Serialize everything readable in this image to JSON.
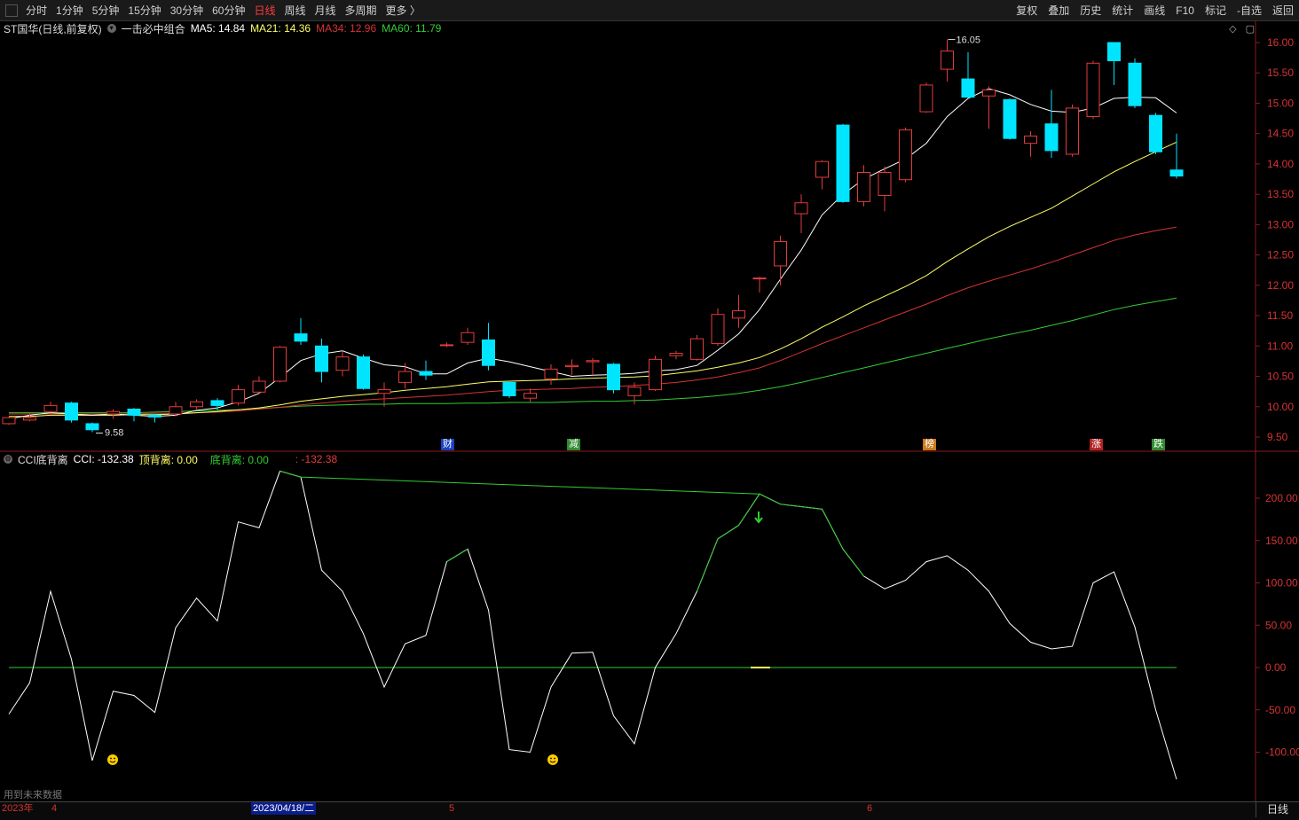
{
  "toolbar": {
    "periods": [
      "分时",
      "1分钟",
      "5分钟",
      "15分钟",
      "30分钟",
      "60分钟",
      "日线",
      "周线",
      "月线",
      "多周期",
      "更多 〉"
    ],
    "active": "日线",
    "right_items": [
      "复权",
      "叠加",
      "历史",
      "统计",
      "画线",
      "F10",
      "标记",
      "-自选",
      "返回"
    ]
  },
  "main": {
    "title": "ST国华(日线,前复权)",
    "indicator": "一击必中组合",
    "ma5": "MA5: 14.84",
    "ma21": "MA21: 14.36",
    "ma34": "MA34: 12.96",
    "ma60": "MA60: 11.79",
    "high_label": "16.05",
    "low_label": "9.58",
    "price_ticks": [
      "16.00",
      "15.50",
      "15.00",
      "14.50",
      "14.00",
      "13.50",
      "13.00",
      "12.50",
      "12.00",
      "11.50",
      "11.00",
      "10.50",
      "10.00",
      "9.50"
    ]
  },
  "badges": [
    {
      "label": "财",
      "color": "#1a3fbf"
    },
    {
      "label": "减",
      "color": "#2e8b2e"
    },
    {
      "label": "榜",
      "color": "#c87a1a"
    },
    {
      "label": "涨",
      "color": "#b22222"
    },
    {
      "label": "跌",
      "color": "#2e8b2e"
    }
  ],
  "sub": {
    "title": "CCI底背离",
    "cci": "CCI: -132.38",
    "top_div": "顶背离: 0.00",
    "bottom_div": "底背离: 0.00",
    "extra": ": -132.38",
    "ticks": [
      "200.00",
      "150.00",
      "100.00",
      "50.00",
      "0.00",
      "-50.00",
      "-100.00"
    ]
  },
  "footer": {
    "watermark": "用到未来数据",
    "year": "2023年",
    "m4": "4",
    "selected_date": "2023/04/18/二",
    "m5": "5",
    "m6": "6",
    "period": "日线"
  },
  "colors": {
    "up": "#e33b3b",
    "down": "#00e5ff",
    "ma5": "#ffffff",
    "ma21": "#ffff66",
    "ma34": "#d63333",
    "ma60": "#33cc33"
  },
  "chart_data": {
    "type": "candlestick",
    "candles": [
      [
        9.72,
        9.82,
        9.84,
        9.7
      ],
      [
        9.78,
        9.82,
        9.9,
        9.76
      ],
      [
        9.92,
        10.02,
        10.08,
        9.9
      ],
      [
        10.06,
        9.78,
        10.08,
        9.74
      ],
      [
        9.72,
        9.62,
        9.74,
        9.58
      ],
      [
        9.88,
        9.92,
        9.96,
        9.8
      ],
      [
        9.96,
        9.86,
        9.98,
        9.76
      ],
      [
        9.86,
        9.83,
        9.88,
        9.74
      ],
      [
        9.88,
        10.0,
        10.08,
        9.84
      ],
      [
        10.0,
        10.08,
        10.12,
        9.96
      ],
      [
        10.1,
        10.02,
        10.14,
        9.94
      ],
      [
        10.06,
        10.28,
        10.36,
        10.02
      ],
      [
        10.24,
        10.42,
        10.5,
        10.22
      ],
      [
        10.42,
        10.98,
        11.0,
        10.4
      ],
      [
        11.2,
        11.08,
        11.46,
        11.02
      ],
      [
        11.0,
        10.58,
        11.12,
        10.4
      ],
      [
        10.6,
        10.82,
        10.9,
        10.5
      ],
      [
        10.82,
        10.3,
        10.86,
        10.28
      ],
      [
        10.22,
        10.28,
        10.4,
        10.0
      ],
      [
        10.4,
        10.58,
        10.72,
        10.3
      ],
      [
        10.58,
        10.52,
        10.76,
        10.44
      ],
      [
        11.02,
        11.02,
        11.06,
        10.98
      ],
      [
        11.06,
        11.22,
        11.3,
        11.02
      ],
      [
        11.1,
        10.68,
        11.38,
        10.6
      ],
      [
        10.4,
        10.18,
        10.42,
        10.14
      ],
      [
        10.14,
        10.22,
        10.3,
        10.08
      ],
      [
        10.46,
        10.62,
        10.7,
        10.36
      ],
      [
        10.66,
        10.68,
        10.78,
        10.52
      ],
      [
        10.74,
        10.76,
        10.8,
        10.52
      ],
      [
        10.7,
        10.28,
        10.72,
        10.22
      ],
      [
        10.18,
        10.32,
        10.4,
        10.04
      ],
      [
        10.28,
        10.78,
        10.84,
        10.26
      ],
      [
        10.84,
        10.88,
        10.92,
        10.78
      ],
      [
        10.78,
        11.12,
        11.18,
        10.76
      ],
      [
        11.04,
        11.52,
        11.62,
        11.0
      ],
      [
        11.46,
        11.58,
        11.84,
        11.3
      ],
      [
        12.12,
        12.12,
        12.14,
        11.88
      ],
      [
        12.32,
        12.72,
        12.82,
        12.0
      ],
      [
        13.18,
        13.36,
        13.5,
        12.86
      ],
      [
        13.78,
        14.04,
        14.06,
        13.58
      ],
      [
        14.64,
        13.38,
        14.66,
        13.36
      ],
      [
        13.38,
        13.86,
        13.98,
        13.3
      ],
      [
        13.48,
        13.86,
        13.96,
        13.22
      ],
      [
        13.74,
        14.56,
        14.6,
        13.7
      ],
      [
        14.86,
        15.3,
        15.34,
        14.84
      ],
      [
        15.56,
        15.86,
        16.05,
        15.36
      ],
      [
        15.4,
        15.1,
        15.84,
        15.08
      ],
      [
        15.12,
        15.22,
        15.28,
        14.58
      ],
      [
        15.06,
        14.42,
        15.08,
        14.4
      ],
      [
        14.34,
        14.46,
        14.54,
        14.12
      ],
      [
        14.66,
        14.22,
        15.22,
        14.1
      ],
      [
        14.16,
        14.92,
        14.98,
        14.12
      ],
      [
        14.78,
        15.66,
        15.7,
        14.74
      ],
      [
        16.0,
        15.7,
        16.0,
        15.3
      ],
      [
        15.66,
        14.96,
        15.74,
        14.92
      ],
      [
        14.8,
        14.2,
        14.84,
        14.16
      ],
      [
        13.9,
        13.8,
        14.5,
        13.76
      ]
    ],
    "ma5": [
      9.8,
      9.86,
      9.9,
      9.88,
      9.86,
      9.88,
      9.86,
      9.84,
      9.86,
      9.94,
      9.98,
      10.08,
      10.22,
      10.48,
      10.76,
      10.87,
      10.92,
      10.8,
      10.69,
      10.66,
      10.54,
      10.54,
      10.72,
      10.8,
      10.74,
      10.66,
      10.58,
      10.5,
      10.52,
      10.53,
      10.55,
      10.59,
      10.61,
      10.68,
      10.93,
      11.2,
      11.6,
      12.1,
      12.58,
      13.16,
      13.5,
      13.75,
      13.92,
      14.08,
      14.34,
      14.78,
      15.08,
      15.24,
      15.14,
      14.98,
      14.87,
      14.85,
      14.92,
      15.08,
      15.1,
      15.09,
      14.84
    ],
    "ma21": [
      9.84,
      9.84,
      9.86,
      9.86,
      9.86,
      9.86,
      9.87,
      9.87,
      9.88,
      9.9,
      9.92,
      9.95,
      9.98,
      10.03,
      10.09,
      10.13,
      10.17,
      10.2,
      10.23,
      10.27,
      10.3,
      10.33,
      10.37,
      10.41,
      10.42,
      10.43,
      10.44,
      10.46,
      10.47,
      10.48,
      10.49,
      10.51,
      10.55,
      10.59,
      10.65,
      10.72,
      10.81,
      10.95,
      11.12,
      11.31,
      11.48,
      11.66,
      11.82,
      11.98,
      12.16,
      12.39,
      12.6,
      12.8,
      12.97,
      13.12,
      13.27,
      13.47,
      13.67,
      13.87,
      14.04,
      14.2,
      14.36
    ],
    "ma34": [
      9.88,
      9.88,
      9.88,
      9.88,
      9.88,
      9.88,
      9.88,
      9.89,
      9.89,
      9.9,
      9.91,
      9.93,
      9.96,
      9.99,
      10.03,
      10.06,
      10.09,
      10.11,
      10.13,
      10.15,
      10.17,
      10.19,
      10.22,
      10.25,
      10.27,
      10.28,
      10.29,
      10.3,
      10.32,
      10.33,
      10.35,
      10.37,
      10.4,
      10.44,
      10.49,
      10.56,
      10.64,
      10.76,
      10.9,
      11.04,
      11.17,
      11.3,
      11.43,
      11.56,
      11.69,
      11.83,
      11.96,
      12.07,
      12.17,
      12.27,
      12.38,
      12.5,
      12.62,
      12.74,
      12.83,
      12.9,
      12.96
    ],
    "ma60": [
      9.9,
      9.9,
      9.9,
      9.9,
      9.9,
      9.9,
      9.9,
      9.91,
      9.92,
      9.93,
      9.94,
      9.95,
      9.97,
      9.99,
      10.01,
      10.02,
      10.03,
      10.04,
      10.04,
      10.05,
      10.05,
      10.05,
      10.06,
      10.06,
      10.07,
      10.07,
      10.07,
      10.08,
      10.09,
      10.09,
      10.1,
      10.11,
      10.13,
      10.15,
      10.18,
      10.22,
      10.27,
      10.33,
      10.4,
      10.48,
      10.56,
      10.64,
      10.72,
      10.8,
      10.88,
      10.96,
      11.04,
      11.12,
      11.19,
      11.26,
      11.34,
      11.42,
      11.51,
      11.6,
      11.67,
      11.73,
      11.79
    ],
    "cci": [
      -55,
      -18,
      90,
      10,
      -110,
      -28,
      -33,
      -53,
      47,
      82,
      55,
      172,
      165,
      232,
      225,
      115,
      90,
      40,
      -23,
      28,
      38,
      125,
      140,
      68,
      -97,
      -100,
      -23,
      17,
      18,
      -57,
      -90,
      0,
      40,
      90,
      152,
      168,
      205,
      193,
      190,
      187,
      140,
      108,
      93,
      103,
      125,
      132,
      115,
      90,
      52,
      30,
      22,
      25,
      100,
      113,
      48,
      -50,
      -132
    ],
    "cci_top_segments": [
      [
        13,
        37
      ],
      [
        37,
        40
      ]
    ],
    "cci_zero": 0
  }
}
